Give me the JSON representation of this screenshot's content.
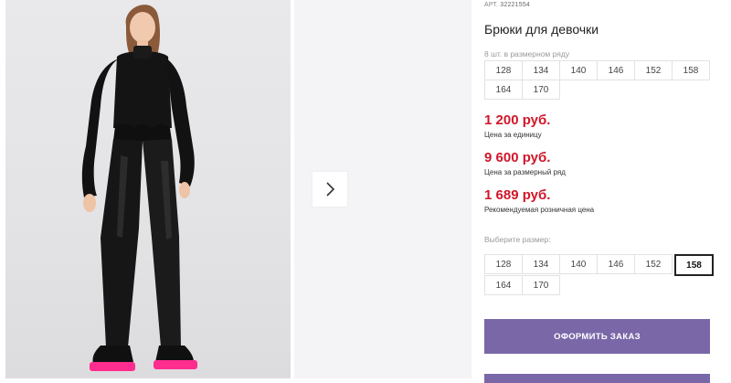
{
  "product": {
    "sku_label": "АРТ.",
    "sku_value": "32221554",
    "title": "Брюки для девочки"
  },
  "size_row": {
    "note": "8 шт. в размерном ряду",
    "sizes": [
      "128",
      "134",
      "140",
      "146",
      "152",
      "158",
      "164",
      "170"
    ]
  },
  "prices": {
    "unit_price": "1 200 руб.",
    "unit_label": "Цена за единицу",
    "row_price": "9 600 руб.",
    "row_label": "Цена за размерный ряд",
    "retail_price": "1 689 руб.",
    "retail_label": "Рекомендуемая розничная цена"
  },
  "size_picker": {
    "label": "Выберите размер:",
    "sizes": [
      "128",
      "134",
      "140",
      "146",
      "152",
      "158",
      "164",
      "170"
    ],
    "selected": "158"
  },
  "actions": {
    "order_label": "ОФОРМИТЬ ЗАКАЗ"
  },
  "colors": {
    "price": "#d0172a",
    "button": "#7a67a8"
  },
  "gallery": {
    "next_icon": "chevron-right-icon"
  }
}
